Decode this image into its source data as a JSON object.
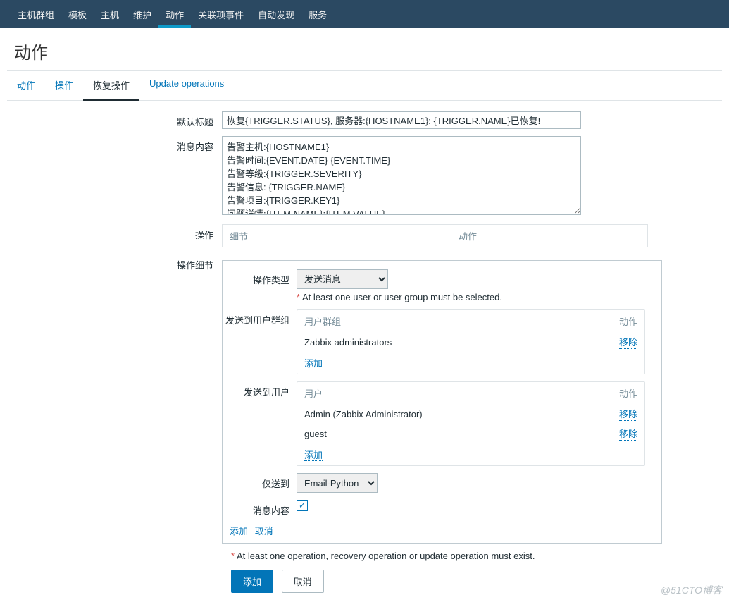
{
  "topnav": {
    "items": [
      "主机群组",
      "模板",
      "主机",
      "维护",
      "动作",
      "关联项事件",
      "自动发现",
      "服务"
    ],
    "activeIndex": 4,
    "caretLeft": 357
  },
  "page": {
    "title": "动作"
  },
  "tabs": {
    "items": [
      "动作",
      "操作",
      "恢复操作",
      "Update operations"
    ],
    "activeIndex": 2
  },
  "form": {
    "defaultSubject": {
      "label": "默认标题",
      "value": "恢复{TRIGGER.STATUS}, 服务器:{HOSTNAME1}: {TRIGGER.NAME}已恢复!"
    },
    "message": {
      "label": "消息内容",
      "value": "告警主机:{HOSTNAME1}\n告警时间:{EVENT.DATE} {EVENT.TIME}\n告警等级:{TRIGGER.SEVERITY}\n告警信息: {TRIGGER.NAME}\n告警项目:{TRIGGER.KEY1}\n问题详情:{ITEM.NAME}:{ITEM.VALUE}"
    },
    "operations": {
      "label": "操作",
      "cols": [
        "细节",
        "动作"
      ]
    },
    "details": {
      "label": "操作细节",
      "opType": {
        "label": "操作类型",
        "value": "发送消息"
      },
      "requireNote": "At least one user or user group must be selected.",
      "sendToGroups": {
        "label": "发送到用户群组",
        "cols": [
          "用户群组",
          "动作"
        ],
        "rows": [
          {
            "name": "Zabbix administrators",
            "action": "移除"
          }
        ],
        "add": "添加"
      },
      "sendToUsers": {
        "label": "发送到用户",
        "cols": [
          "用户",
          "动作"
        ],
        "rows": [
          {
            "name": "Admin (Zabbix Administrator)",
            "action": "移除"
          },
          {
            "name": "guest",
            "action": "移除"
          }
        ],
        "add": "添加"
      },
      "sendOnlyTo": {
        "label": "仅送到",
        "value": "Email-Python"
      },
      "msgContent": {
        "label": "消息内容",
        "checked": true
      },
      "actions": {
        "add": "添加",
        "cancel": "取消"
      }
    },
    "finalNote": "At least one operation, recovery operation or update operation must exist.",
    "buttons": {
      "add": "添加",
      "cancel": "取消"
    }
  },
  "watermark": "@51CTO博客"
}
